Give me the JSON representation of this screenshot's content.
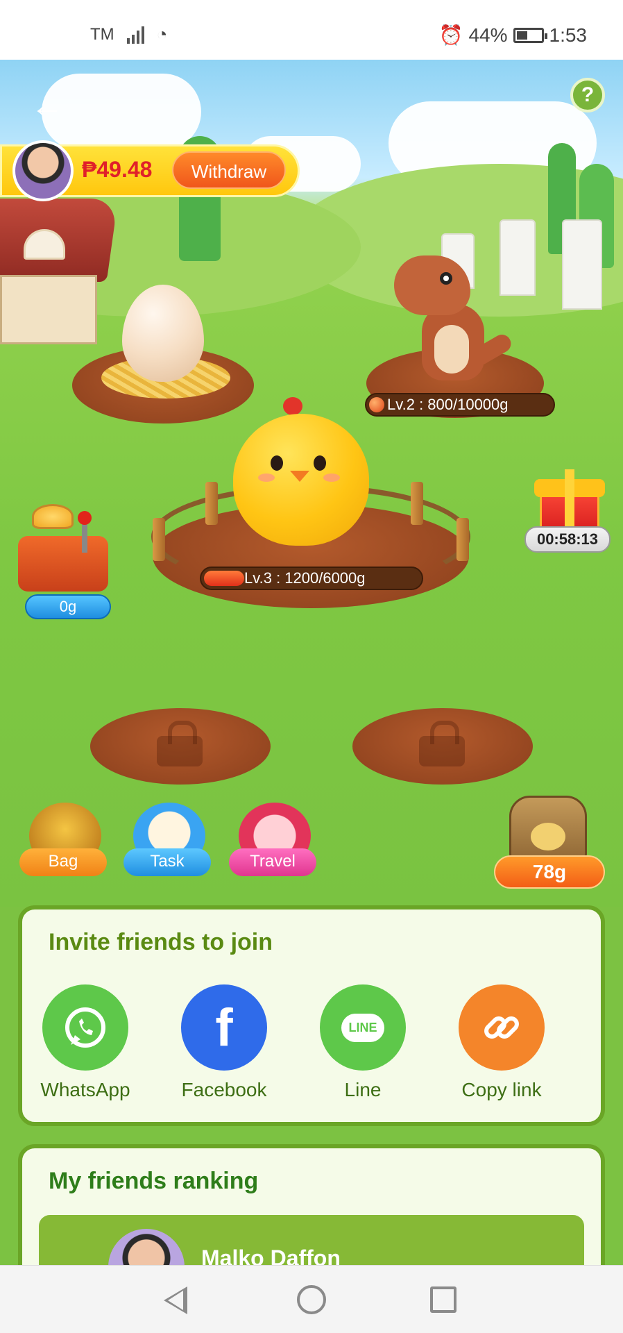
{
  "status_bar": {
    "carrier": "TM",
    "battery": "44%",
    "time": "1:53",
    "icons": [
      "signal-icon",
      "wifi-icon",
      "alarm-icon",
      "battery-icon"
    ]
  },
  "header": {
    "balance": "₱49.48",
    "withdraw_label": "Withdraw",
    "help_label": "?"
  },
  "farm": {
    "dino_level": "Lv.2 : 800/10000g",
    "chick_level": "Lv.3 : 1200/6000g",
    "gift_timer": "00:58:13",
    "feeder_amount": "0g",
    "feed_amount": "78g"
  },
  "actions": {
    "bag_label": "Bag",
    "task_label": "Task",
    "travel_label": "Travel"
  },
  "invite": {
    "title": "Invite friends to join",
    "options": [
      {
        "label": "WhatsApp",
        "icon": "whatsapp-icon",
        "color": "#5ec84a"
      },
      {
        "label": "Facebook",
        "icon": "facebook-icon",
        "color": "#2f6bea"
      },
      {
        "label": "Line",
        "icon": "line-icon",
        "color": "#5ec84a"
      },
      {
        "label": "Copy link",
        "icon": "link-icon",
        "color": "#f4852a"
      }
    ],
    "line_badge": "LINE"
  },
  "ranking": {
    "title": "My friends ranking",
    "friends": [
      {
        "name": "Malko Daffon"
      }
    ]
  },
  "colors": {
    "accent_green": "#6aa526",
    "withdraw_orange": "#f0561b",
    "balance_red": "#e0202a"
  }
}
